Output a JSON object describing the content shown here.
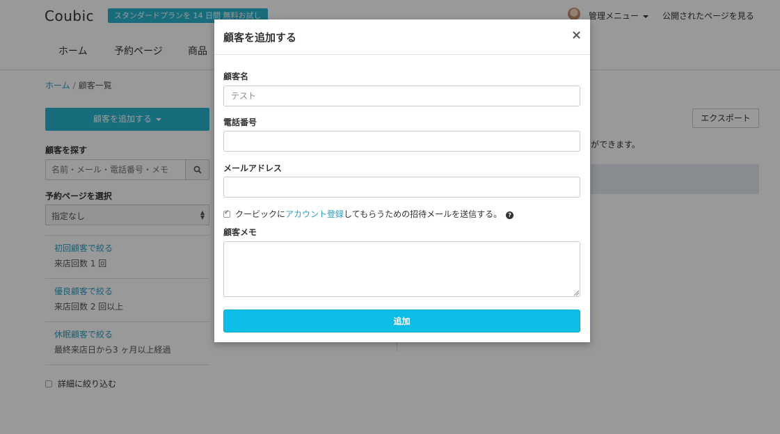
{
  "header": {
    "logo": "Coubic",
    "trial_badge": "スタンダードプランを 14 日間 無料お試し",
    "admin_menu": "管理メニュー",
    "view_public": "公開されたページを見る",
    "nav": [
      "ホーム",
      "予約ページ",
      "商品"
    ]
  },
  "sidebar": {
    "breadcrumb_home": "ホーム",
    "breadcrumb_sep": "/",
    "breadcrumb_current": "顧客一覧",
    "add_customer": "顧客を追加する",
    "search_label": "顧客を探す",
    "search_placeholder": "名前・メール・電話番号・メモ",
    "booking_label": "予約ページを選択",
    "booking_selected": "指定なし",
    "filters": [
      {
        "title": "初回顧客で絞る",
        "desc": "来店回数 1 回"
      },
      {
        "title": "優良顧客で絞る",
        "desc": "来店回数 2 回以上"
      },
      {
        "title": "休眠顧客で絞る",
        "desc": "最終来店日から3 ヶ月以上経過"
      }
    ],
    "detail_filter": "詳細に絞り込む"
  },
  "main": {
    "export": "エクスポート",
    "partial_text": "ができます。"
  },
  "modal": {
    "title": "顧客を追加する",
    "close": "×",
    "name_label": "顧客名",
    "name_placeholder": "テスト",
    "phone_label": "電話番号",
    "email_label": "メールアドレス",
    "invite_prefix": "クービックに",
    "invite_link": "アカウント登録",
    "invite_suffix": "してもらうための招待メールを送信する。",
    "memo_label": "顧客メモ",
    "submit": "追加"
  },
  "colors": {
    "accent": "#29b6d1",
    "submit": "#0cbde6",
    "link": "#2a9fc1"
  }
}
